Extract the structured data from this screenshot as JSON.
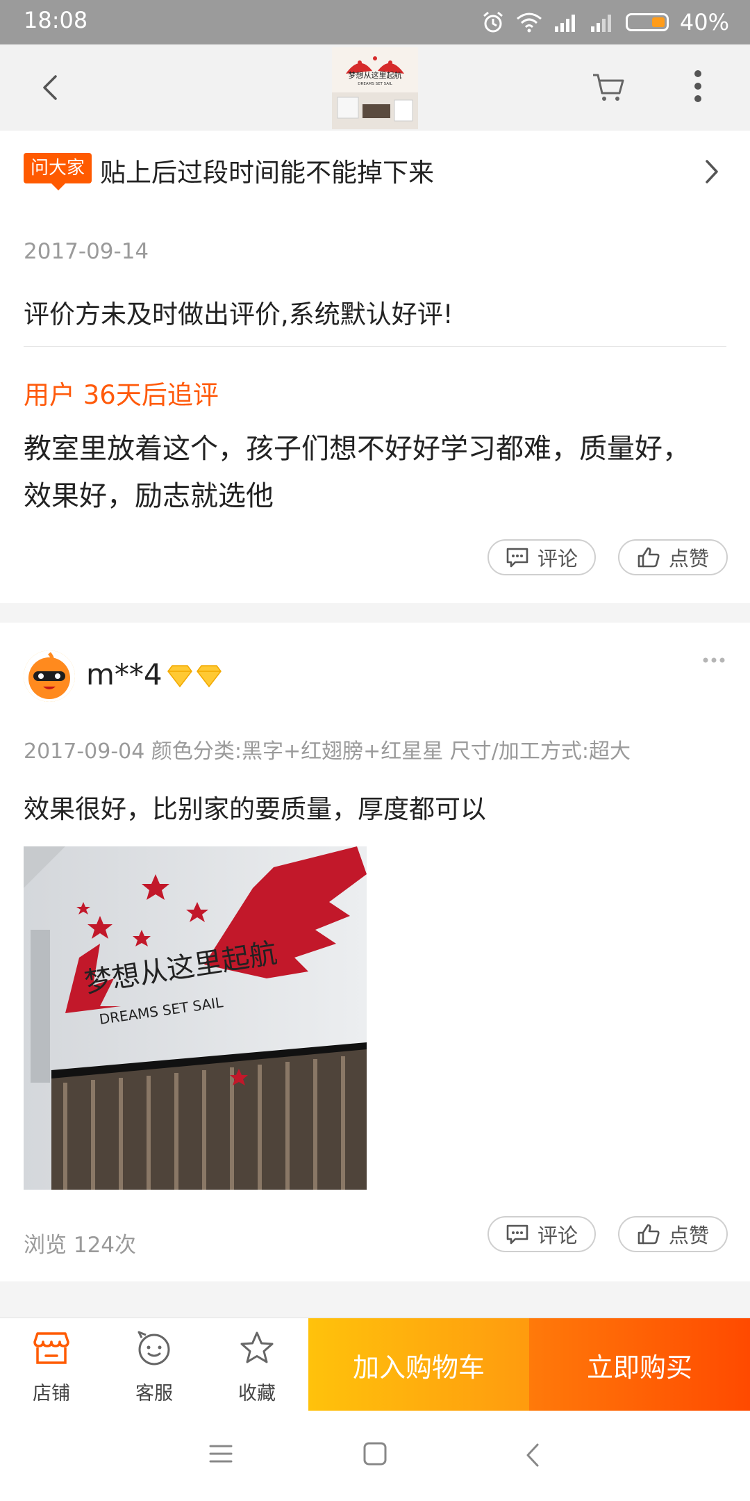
{
  "status_bar": {
    "time": "18:08",
    "battery": "40%",
    "battery_level": 0.4
  },
  "top_nav": {
    "product_thumb_text": "梦想从这里起航",
    "product_thumb_subtext": "DREAMS SET SAIL"
  },
  "ask": {
    "badge": "问大家",
    "question": "贴上后过段时间能不能掉下来"
  },
  "review1": {
    "date": "2017-09-14",
    "text": "评价方未及时做出评价,系统默认好评!",
    "followup_title": "用户 36天后追评",
    "followup_text": "教室里放着这个，孩子们想不好好学习都难，质量好，效果好，励志就选他",
    "comment_label": "评论",
    "like_label": "点赞"
  },
  "review2": {
    "username": "m**4",
    "meta": "2017-09-04 颜色分类:黑字+红翅膀+红星星 尺寸/加工方式:超大",
    "text": "效果很好，比别家的要质量，厚度都可以",
    "photo_text": "梦想从这里起航",
    "photo_subtext": "DREAMS SET SAIL",
    "views": "浏览 124次",
    "comment_label": "评论",
    "like_label": "点赞"
  },
  "action_bar": {
    "store": "店铺",
    "service": "客服",
    "favorite": "收藏",
    "add_to_cart": "加入购物车",
    "buy_now": "立即购买"
  },
  "colors": {
    "accent_orange": "#ff5a00",
    "cart_button": "#ffae0d",
    "buy_button": "#ff5a05"
  }
}
